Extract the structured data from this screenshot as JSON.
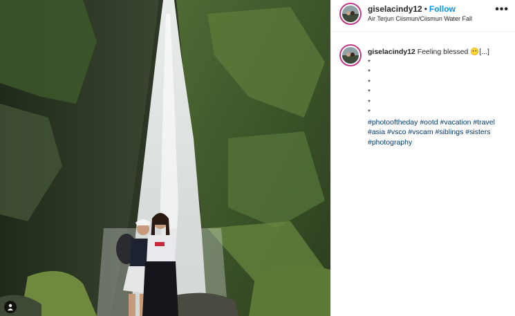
{
  "post": {
    "username": "giselacindy12",
    "follow_label": "Follow",
    "separator": "•",
    "location": "Air Terjun Ciismun/Ciismun Water Fall",
    "more_label": "•••"
  },
  "caption": {
    "username": "giselacindy12",
    "text": "Feeling blessed",
    "emoji": "😶",
    "truncation": "[...]",
    "asterisks": [
      "*",
      "*",
      "*",
      "*",
      "*",
      "*"
    ],
    "hashtags": [
      "#photooftheday",
      "#ootd",
      "#vacation",
      "#travel",
      "#asia",
      "#vsco",
      "#vscam",
      "#siblings",
      "#sisters",
      "#photography"
    ]
  },
  "colors": {
    "follow": "#0095f6",
    "hashtag": "#00376b",
    "avatar_ring": "#c13584"
  },
  "icons": {
    "user_tag": "person-icon",
    "more": "more-options-icon"
  }
}
